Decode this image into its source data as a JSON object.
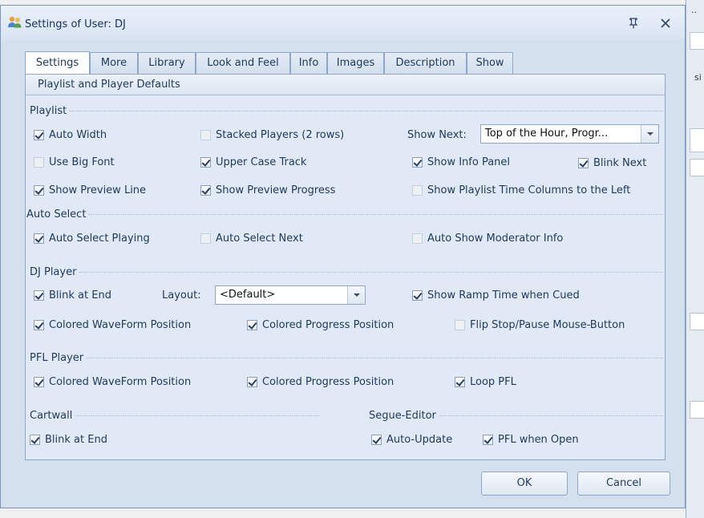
{
  "window": {
    "title": "Settings of User: DJ"
  },
  "tabs": [
    "Settings",
    "More",
    "Library",
    "Look and Feel",
    "Info",
    "Images",
    "Description",
    "Show"
  ],
  "panel": {
    "header": "Playlist and Player Defaults"
  },
  "sections": {
    "playlist": "Playlist",
    "auto_select": "Auto Select",
    "dj_player": "DJ Player",
    "pfl_player": "PFL Player",
    "cartwall": "Cartwall",
    "segue_editor": "Segue-Editor"
  },
  "checkboxes": {
    "auto_width": {
      "label": "Auto Width",
      "checked": true
    },
    "stacked_players": {
      "label": "Stacked Players (2 rows)",
      "checked": false
    },
    "use_big_font": {
      "label": "Use Big Font",
      "checked": false
    },
    "upper_case_track": {
      "label": "Upper Case Track",
      "checked": true
    },
    "show_info_panel": {
      "label": "Show Info Panel",
      "checked": true
    },
    "blink_next": {
      "label": "Blink Next",
      "checked": true
    },
    "show_preview_line": {
      "label": "Show Preview Line",
      "checked": true
    },
    "show_preview_progress": {
      "label": "Show Preview Progress",
      "checked": true
    },
    "show_time_columns_left": {
      "label": "Show Playlist Time Columns to the Left",
      "checked": false
    },
    "auto_select_playing": {
      "label": "Auto Select Playing",
      "checked": true
    },
    "auto_select_next": {
      "label": "Auto Select Next",
      "checked": false
    },
    "auto_show_moderator_info": {
      "label": "Auto Show Moderator Info",
      "checked": false
    },
    "dj_blink_at_end": {
      "label": "Blink at End",
      "checked": true
    },
    "show_ramp_time": {
      "label": "Show Ramp Time when Cued",
      "checked": true
    },
    "dj_colored_waveform": {
      "label": "Colored WaveForm Position",
      "checked": true
    },
    "dj_colored_progress": {
      "label": "Colored Progress Position",
      "checked": true
    },
    "flip_stop_pause": {
      "label": "Flip Stop/Pause Mouse-Button",
      "checked": false
    },
    "pfl_colored_waveform": {
      "label": "Colored WaveForm Position",
      "checked": true
    },
    "pfl_colored_progress": {
      "label": "Colored Progress Position",
      "checked": true
    },
    "loop_pfl": {
      "label": "Loop PFL",
      "checked": true
    },
    "cart_blink_at_end": {
      "label": "Blink at End",
      "checked": true
    },
    "auto_update": {
      "label": "Auto-Update",
      "checked": true
    },
    "pfl_when_open": {
      "label": "PFL when Open",
      "checked": true
    }
  },
  "show_next": {
    "label": "Show Next:",
    "value": "Top of the Hour, Progr..."
  },
  "layout": {
    "label": "Layout:",
    "value": "<Default>"
  },
  "buttons": {
    "ok": "OK",
    "cancel": "Cancel"
  },
  "background": {
    "dots": "..",
    "fragment": "si"
  }
}
